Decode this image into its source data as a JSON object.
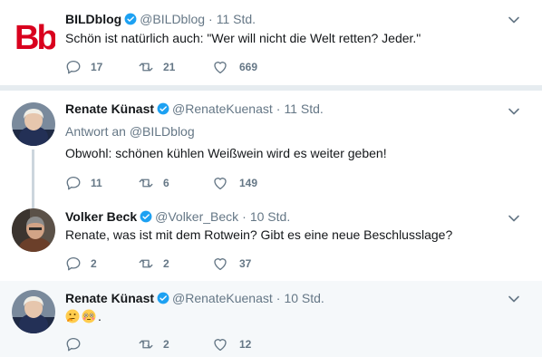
{
  "tweets": [
    {
      "name": "BILDblog",
      "handle": "@BILDblog",
      "dot": "·",
      "time": "11 Std.",
      "logo_text": "Bb",
      "text": "Schön ist natürlich auch: \"Wer will nicht die Welt retten? Jeder.\"",
      "reply_count": "17",
      "retweet_count": "21",
      "like_count": "669"
    },
    {
      "name": "Renate Künast",
      "handle": "@RenateKuenast",
      "dot": "·",
      "time": "11 Std.",
      "reply_to_prefix": "Antwort an",
      "reply_to_handle": "@BILDblog",
      "text": "Obwohl: schönen kühlen Weißwein wird es weiter geben!",
      "reply_count": "11",
      "retweet_count": "6",
      "like_count": "149"
    },
    {
      "name": "Volker Beck",
      "handle": "@Volker_Beck",
      "dot": "·",
      "time": "10 Std.",
      "text": "Renate, was ist mit dem Rotwein? Gibt es eine neue Beschlusslage?",
      "reply_count": "2",
      "retweet_count": "2",
      "like_count": "37"
    },
    {
      "name": "Renate Künast",
      "handle": "@RenateKuenast",
      "dot": "·",
      "time": "10 Std.",
      "emojis": [
        "thinking-face",
        "flushed-face"
      ],
      "text_suffix": ".",
      "reply_count": "",
      "retweet_count": "2",
      "like_count": "12"
    }
  ],
  "colors": {
    "background": "#e6ecf0",
    "card": "#ffffff",
    "card_alt": "#f5f8fa",
    "verified": "#1da1f2",
    "secondary_text": "#657786",
    "logo_red": "#d9001e"
  },
  "icons": [
    "verified-badge-icon",
    "chevron-down-icon",
    "reply-icon",
    "retweet-icon",
    "like-heart-icon"
  ]
}
